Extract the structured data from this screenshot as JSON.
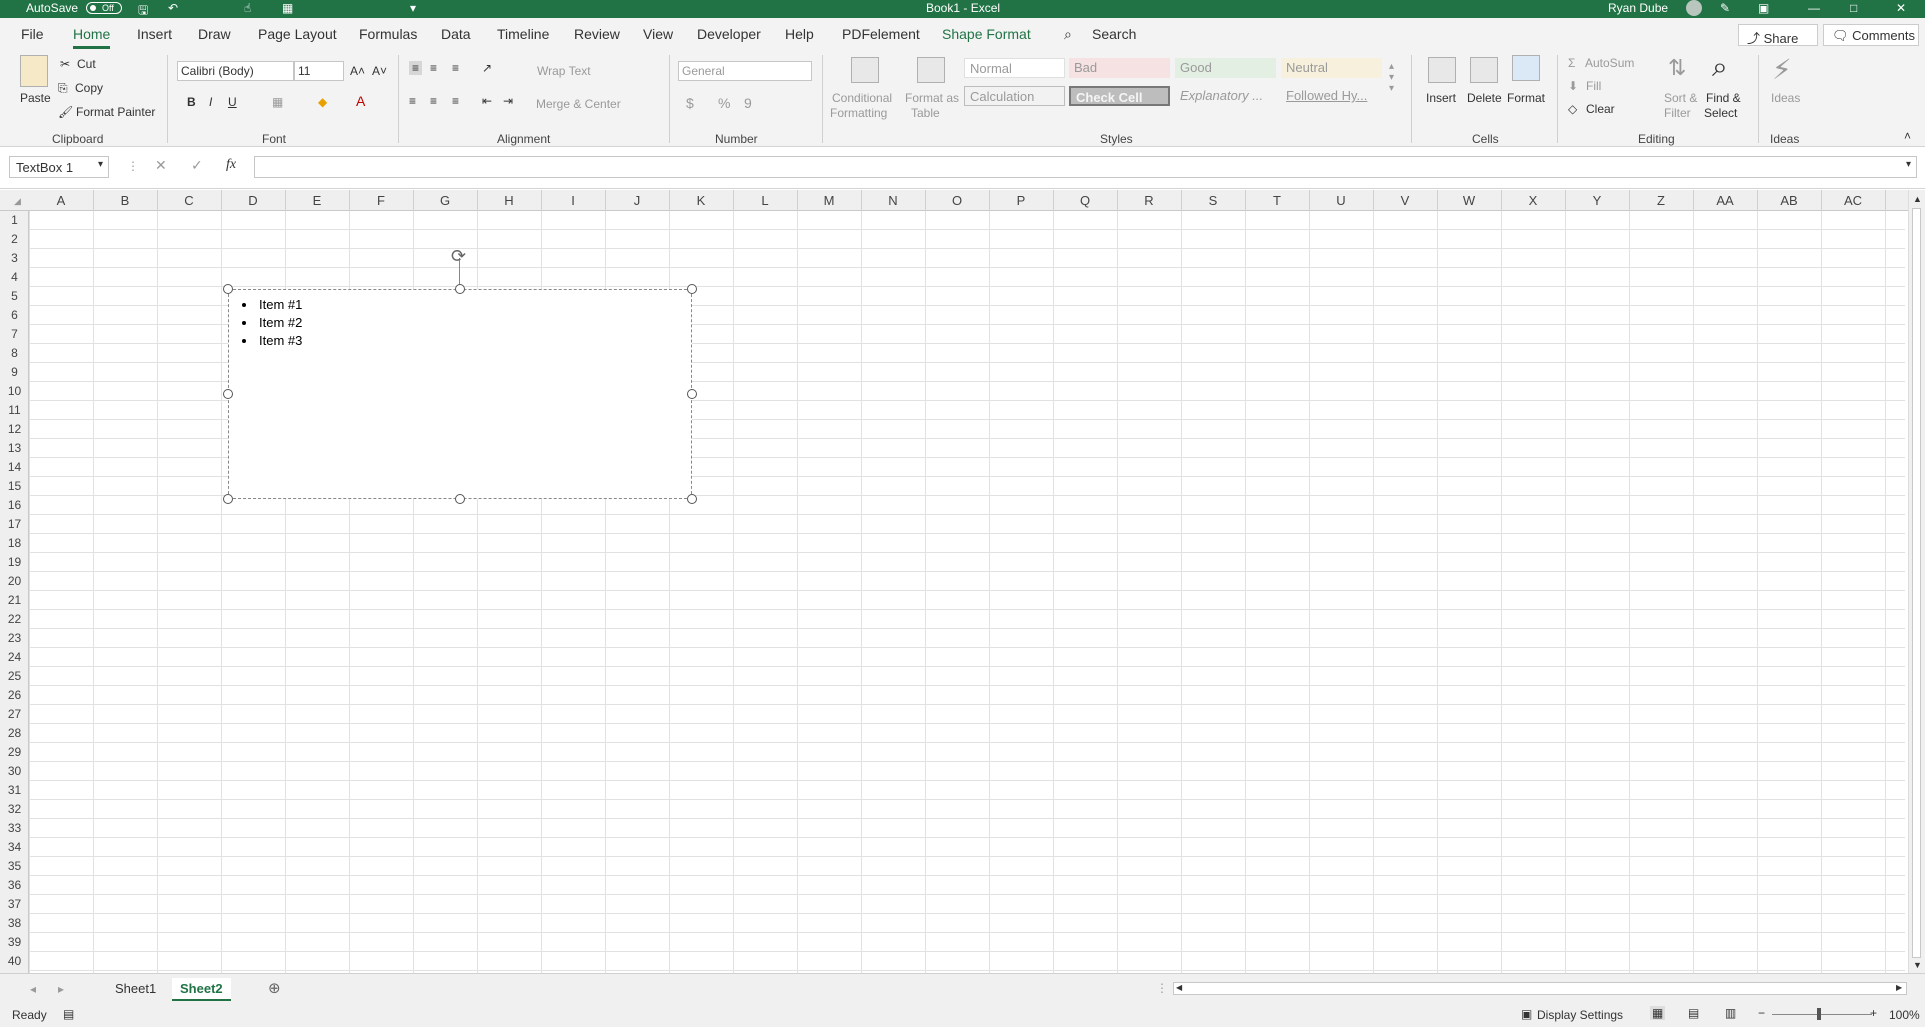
{
  "titlebar": {
    "autosave": "AutoSave",
    "autosave_state": "Off",
    "doc_title": "Book1 - Excel",
    "user": "Ryan Dube"
  },
  "tabs": [
    "File",
    "Home",
    "Insert",
    "Draw",
    "Page Layout",
    "Formulas",
    "Data",
    "Timeline",
    "Review",
    "View",
    "Developer",
    "Help",
    "PDFelement",
    "Shape Format"
  ],
  "search_label": "Search",
  "share_label": "Share",
  "comments_label": "Comments",
  "clipboard": {
    "paste": "Paste",
    "cut": "Cut",
    "copy": "Copy",
    "format_painter": "Format Painter",
    "group": "Clipboard"
  },
  "font": {
    "name": "Calibri (Body)",
    "size": "11",
    "bold": "B",
    "italic": "I",
    "underline": "U",
    "group": "Font"
  },
  "alignment": {
    "wrap": "Wrap Text",
    "merge": "Merge & Center",
    "group": "Alignment"
  },
  "number": {
    "format": "General",
    "currency": "$",
    "percent": "%",
    "comma": "9",
    "group": "Number"
  },
  "styles": {
    "conditional": "Conditional",
    "conditional2": "Formatting",
    "format_as": "Format as",
    "format_as2": "Table",
    "cells": [
      "Normal",
      "Bad",
      "Good",
      "Neutral",
      "Calculation",
      "Check Cell",
      "Explanatory ...",
      "Followed Hy..."
    ],
    "group": "Styles"
  },
  "cells_group": {
    "insert": "Insert",
    "delete": "Delete",
    "format": "Format",
    "group": "Cells"
  },
  "editing": {
    "autosum": "AutoSum",
    "fill": "Fill",
    "clear": "Clear",
    "sort": "Sort &",
    "sort2": "Filter",
    "find": "Find &",
    "find2": "Select",
    "group": "Editing"
  },
  "ideas": {
    "label": "Ideas",
    "group": "Ideas"
  },
  "formula_bar": {
    "name_box": "TextBox 1",
    "fx": "fx",
    "value": ""
  },
  "columns": [
    "A",
    "B",
    "C",
    "D",
    "E",
    "F",
    "G",
    "H",
    "I",
    "J",
    "K",
    "L",
    "M",
    "N",
    "O",
    "P",
    "Q",
    "R",
    "S",
    "T",
    "U",
    "V",
    "W",
    "X",
    "Y",
    "Z",
    "AA",
    "AB",
    "AC"
  ],
  "rows": [
    "1",
    "2",
    "3",
    "4",
    "5",
    "6",
    "7",
    "8",
    "9",
    "10",
    "11",
    "12",
    "13",
    "14",
    "15",
    "16",
    "17",
    "18",
    "19",
    "20",
    "21",
    "22",
    "23",
    "24",
    "25",
    "26",
    "27",
    "28",
    "29",
    "30",
    "31",
    "32",
    "33",
    "34",
    "35",
    "36",
    "37",
    "38",
    "39",
    "40"
  ],
  "textbox": {
    "items": [
      "Item #1",
      "Item #2",
      "Item #3"
    ]
  },
  "sheets": [
    "Sheet1",
    "Sheet2"
  ],
  "active_sheet": "Sheet2",
  "status": {
    "ready": "Ready",
    "display_settings": "Display Settings",
    "zoom": "100%"
  }
}
